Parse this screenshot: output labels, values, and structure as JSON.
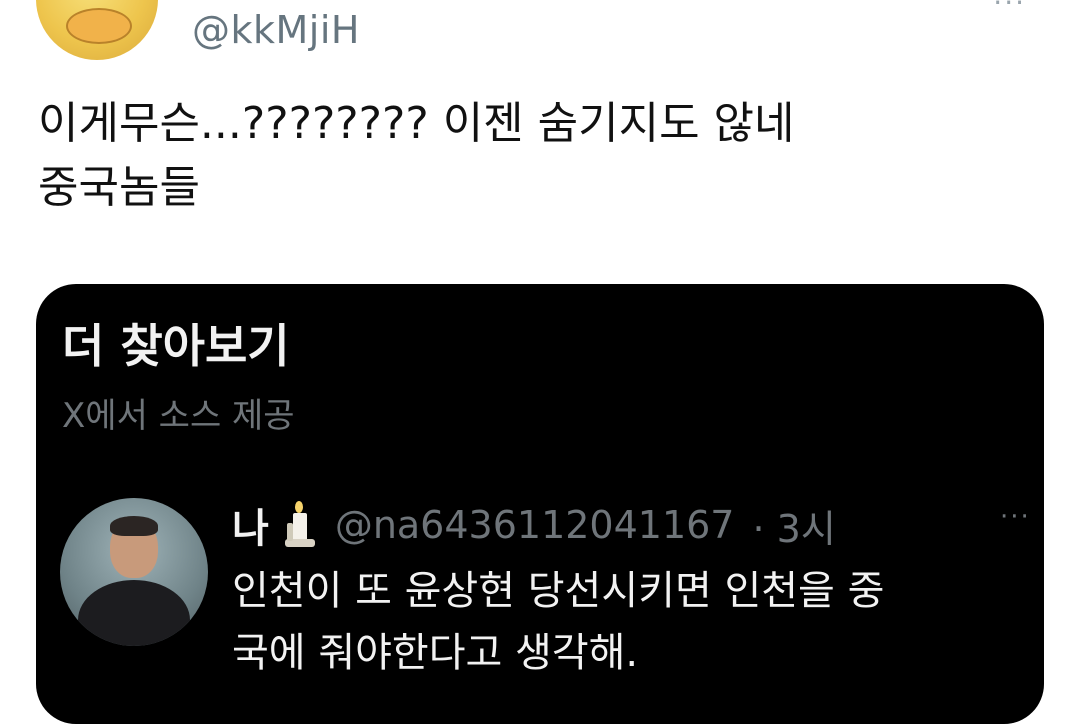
{
  "tweet": {
    "handle": "@kkMjiH",
    "more_icon": "more-icon",
    "text": "이게무슨...???????? 이젠 숨기지도 않네\n중국놈들"
  },
  "card": {
    "title": "더 찾아보기",
    "source": "X에서 소스 제공",
    "reply": {
      "name": "나",
      "emoji_icon": "candle-icon",
      "handle": "@na6436112041167",
      "time": "· 3시",
      "more_icon": "more-icon",
      "text": "인천이 또 윤상현 당선시키면 인천을 중\n국에 줘야한다고 생각해."
    }
  }
}
